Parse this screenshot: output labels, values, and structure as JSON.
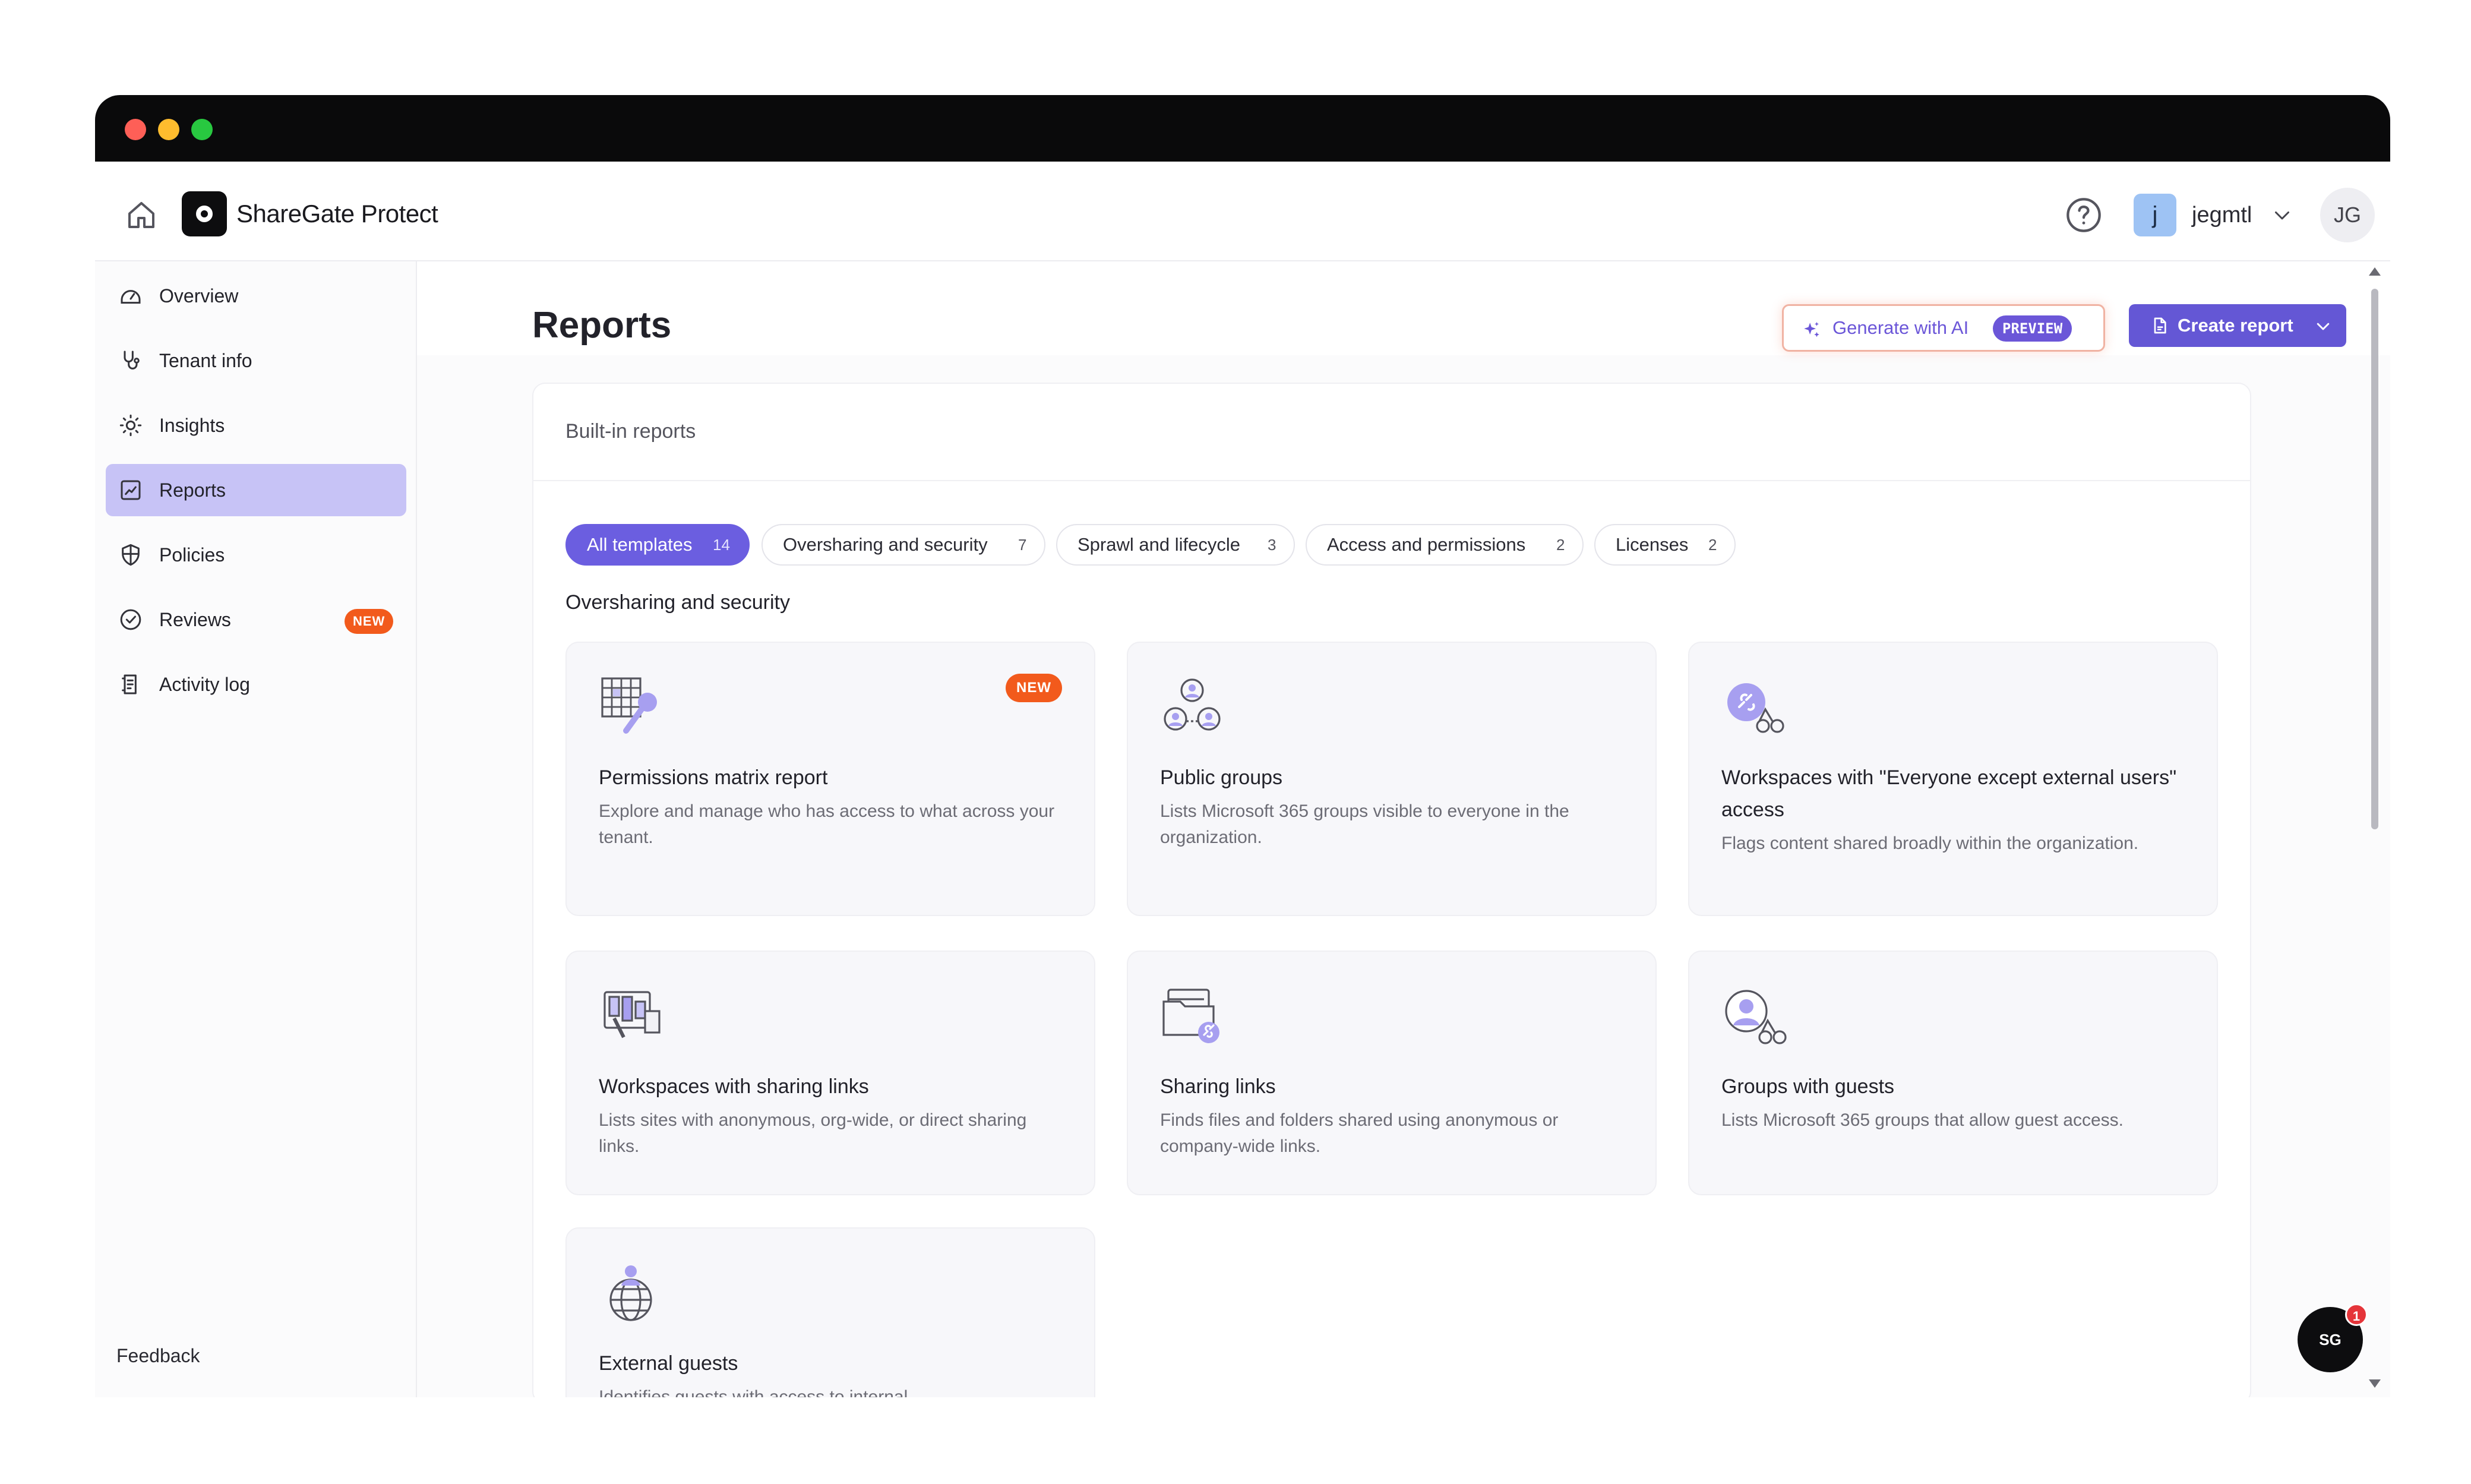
{
  "app": {
    "title": "ShareGate Protect",
    "tenant_initial": "j",
    "tenant_name": "jegmtl",
    "user_initials": "JG"
  },
  "sidebar": {
    "items": [
      {
        "label": "Overview",
        "icon": "gauge-icon"
      },
      {
        "label": "Tenant info",
        "icon": "stethoscope-icon"
      },
      {
        "label": "Insights",
        "icon": "lightbulb-icon"
      },
      {
        "label": "Reports",
        "icon": "report-icon",
        "active": true
      },
      {
        "label": "Policies",
        "icon": "shield-icon"
      },
      {
        "label": "Reviews",
        "icon": "check-badge-icon",
        "badge": "NEW"
      },
      {
        "label": "Activity log",
        "icon": "clipboard-icon"
      }
    ],
    "feedback": "Feedback"
  },
  "page": {
    "title": "Reports",
    "ai_button": "Generate with AI",
    "ai_badge": "PREVIEW",
    "create_button": "Create report"
  },
  "panel": {
    "title": "Built-in reports",
    "filters": [
      {
        "label": "All templates",
        "count": "14",
        "active": true
      },
      {
        "label": "Oversharing and security",
        "count": "7"
      },
      {
        "label": "Sprawl and lifecycle",
        "count": "3"
      },
      {
        "label": "Access and permissions",
        "count": "2"
      },
      {
        "label": "Licenses",
        "count": "2"
      }
    ],
    "section": "Oversharing and security",
    "cards": [
      {
        "title": "Permissions matrix report",
        "desc": "Explore and manage who has access to what across your tenant.",
        "badge": "NEW",
        "icon": "matrix-key-icon"
      },
      {
        "title": "Public groups",
        "desc": "Lists Microsoft 365 groups visible to everyone in the organization.",
        "icon": "people-group-icon"
      },
      {
        "title": "Workspaces with \"Everyone except external users\" access",
        "desc": "Flags content shared broadly within the organization.",
        "icon": "link-people-icon"
      },
      {
        "title": "Workspaces with sharing links",
        "desc": "Lists sites with anonymous, org-wide, or direct sharing links.",
        "icon": "workspace-links-icon"
      },
      {
        "title": "Sharing links",
        "desc": "Finds files and folders shared using anonymous or company-wide links.",
        "icon": "folder-link-icon"
      },
      {
        "title": "Groups with guests",
        "desc": "Lists Microsoft 365 groups that allow guest access.",
        "icon": "guest-group-icon"
      },
      {
        "title": "External guests",
        "desc": "Identifies guests with access to internal",
        "icon": "globe-person-icon"
      }
    ]
  },
  "chat": {
    "label": "SG",
    "count": "1"
  },
  "colors": {
    "accent": "#6b5ee0",
    "active_nav": "#c7c3f6",
    "badge": "#f25a1c"
  }
}
